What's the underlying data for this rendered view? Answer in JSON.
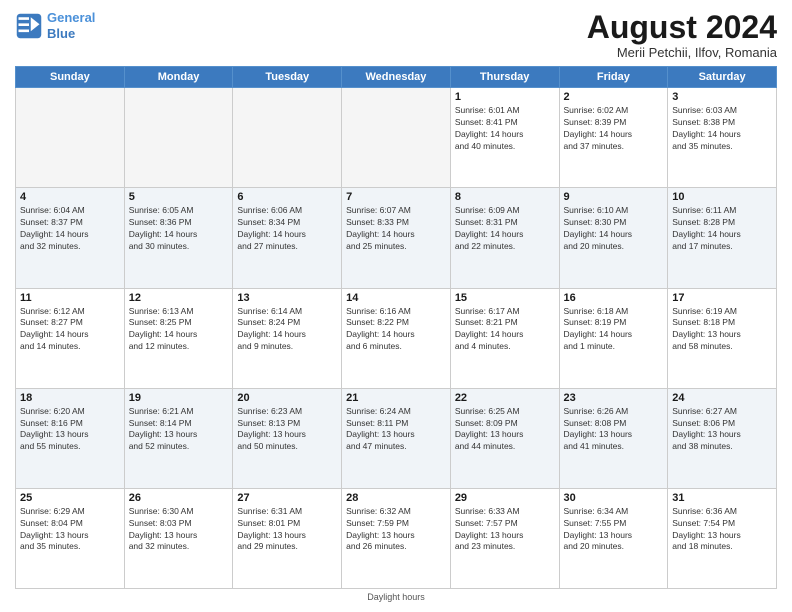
{
  "header": {
    "logo_line1": "General",
    "logo_line2": "Blue",
    "month_title": "August 2024",
    "subtitle": "Merii Petchii, Ilfov, Romania"
  },
  "days_of_week": [
    "Sunday",
    "Monday",
    "Tuesday",
    "Wednesday",
    "Thursday",
    "Friday",
    "Saturday"
  ],
  "footer": "Daylight hours",
  "weeks": [
    [
      {
        "day": "",
        "info": "",
        "empty": true
      },
      {
        "day": "",
        "info": "",
        "empty": true
      },
      {
        "day": "",
        "info": "",
        "empty": true
      },
      {
        "day": "",
        "info": "",
        "empty": true
      },
      {
        "day": "1",
        "info": "Sunrise: 6:01 AM\nSunset: 8:41 PM\nDaylight: 14 hours\nand 40 minutes."
      },
      {
        "day": "2",
        "info": "Sunrise: 6:02 AM\nSunset: 8:39 PM\nDaylight: 14 hours\nand 37 minutes."
      },
      {
        "day": "3",
        "info": "Sunrise: 6:03 AM\nSunset: 8:38 PM\nDaylight: 14 hours\nand 35 minutes."
      }
    ],
    [
      {
        "day": "4",
        "info": "Sunrise: 6:04 AM\nSunset: 8:37 PM\nDaylight: 14 hours\nand 32 minutes."
      },
      {
        "day": "5",
        "info": "Sunrise: 6:05 AM\nSunset: 8:36 PM\nDaylight: 14 hours\nand 30 minutes."
      },
      {
        "day": "6",
        "info": "Sunrise: 6:06 AM\nSunset: 8:34 PM\nDaylight: 14 hours\nand 27 minutes."
      },
      {
        "day": "7",
        "info": "Sunrise: 6:07 AM\nSunset: 8:33 PM\nDaylight: 14 hours\nand 25 minutes."
      },
      {
        "day": "8",
        "info": "Sunrise: 6:09 AM\nSunset: 8:31 PM\nDaylight: 14 hours\nand 22 minutes."
      },
      {
        "day": "9",
        "info": "Sunrise: 6:10 AM\nSunset: 8:30 PM\nDaylight: 14 hours\nand 20 minutes."
      },
      {
        "day": "10",
        "info": "Sunrise: 6:11 AM\nSunset: 8:28 PM\nDaylight: 14 hours\nand 17 minutes."
      }
    ],
    [
      {
        "day": "11",
        "info": "Sunrise: 6:12 AM\nSunset: 8:27 PM\nDaylight: 14 hours\nand 14 minutes."
      },
      {
        "day": "12",
        "info": "Sunrise: 6:13 AM\nSunset: 8:25 PM\nDaylight: 14 hours\nand 12 minutes."
      },
      {
        "day": "13",
        "info": "Sunrise: 6:14 AM\nSunset: 8:24 PM\nDaylight: 14 hours\nand 9 minutes."
      },
      {
        "day": "14",
        "info": "Sunrise: 6:16 AM\nSunset: 8:22 PM\nDaylight: 14 hours\nand 6 minutes."
      },
      {
        "day": "15",
        "info": "Sunrise: 6:17 AM\nSunset: 8:21 PM\nDaylight: 14 hours\nand 4 minutes."
      },
      {
        "day": "16",
        "info": "Sunrise: 6:18 AM\nSunset: 8:19 PM\nDaylight: 14 hours\nand 1 minute."
      },
      {
        "day": "17",
        "info": "Sunrise: 6:19 AM\nSunset: 8:18 PM\nDaylight: 13 hours\nand 58 minutes."
      }
    ],
    [
      {
        "day": "18",
        "info": "Sunrise: 6:20 AM\nSunset: 8:16 PM\nDaylight: 13 hours\nand 55 minutes."
      },
      {
        "day": "19",
        "info": "Sunrise: 6:21 AM\nSunset: 8:14 PM\nDaylight: 13 hours\nand 52 minutes."
      },
      {
        "day": "20",
        "info": "Sunrise: 6:23 AM\nSunset: 8:13 PM\nDaylight: 13 hours\nand 50 minutes."
      },
      {
        "day": "21",
        "info": "Sunrise: 6:24 AM\nSunset: 8:11 PM\nDaylight: 13 hours\nand 47 minutes."
      },
      {
        "day": "22",
        "info": "Sunrise: 6:25 AM\nSunset: 8:09 PM\nDaylight: 13 hours\nand 44 minutes."
      },
      {
        "day": "23",
        "info": "Sunrise: 6:26 AM\nSunset: 8:08 PM\nDaylight: 13 hours\nand 41 minutes."
      },
      {
        "day": "24",
        "info": "Sunrise: 6:27 AM\nSunset: 8:06 PM\nDaylight: 13 hours\nand 38 minutes."
      }
    ],
    [
      {
        "day": "25",
        "info": "Sunrise: 6:29 AM\nSunset: 8:04 PM\nDaylight: 13 hours\nand 35 minutes."
      },
      {
        "day": "26",
        "info": "Sunrise: 6:30 AM\nSunset: 8:03 PM\nDaylight: 13 hours\nand 32 minutes."
      },
      {
        "day": "27",
        "info": "Sunrise: 6:31 AM\nSunset: 8:01 PM\nDaylight: 13 hours\nand 29 minutes."
      },
      {
        "day": "28",
        "info": "Sunrise: 6:32 AM\nSunset: 7:59 PM\nDaylight: 13 hours\nand 26 minutes."
      },
      {
        "day": "29",
        "info": "Sunrise: 6:33 AM\nSunset: 7:57 PM\nDaylight: 13 hours\nand 23 minutes."
      },
      {
        "day": "30",
        "info": "Sunrise: 6:34 AM\nSunset: 7:55 PM\nDaylight: 13 hours\nand 20 minutes."
      },
      {
        "day": "31",
        "info": "Sunrise: 6:36 AM\nSunset: 7:54 PM\nDaylight: 13 hours\nand 18 minutes."
      }
    ]
  ]
}
